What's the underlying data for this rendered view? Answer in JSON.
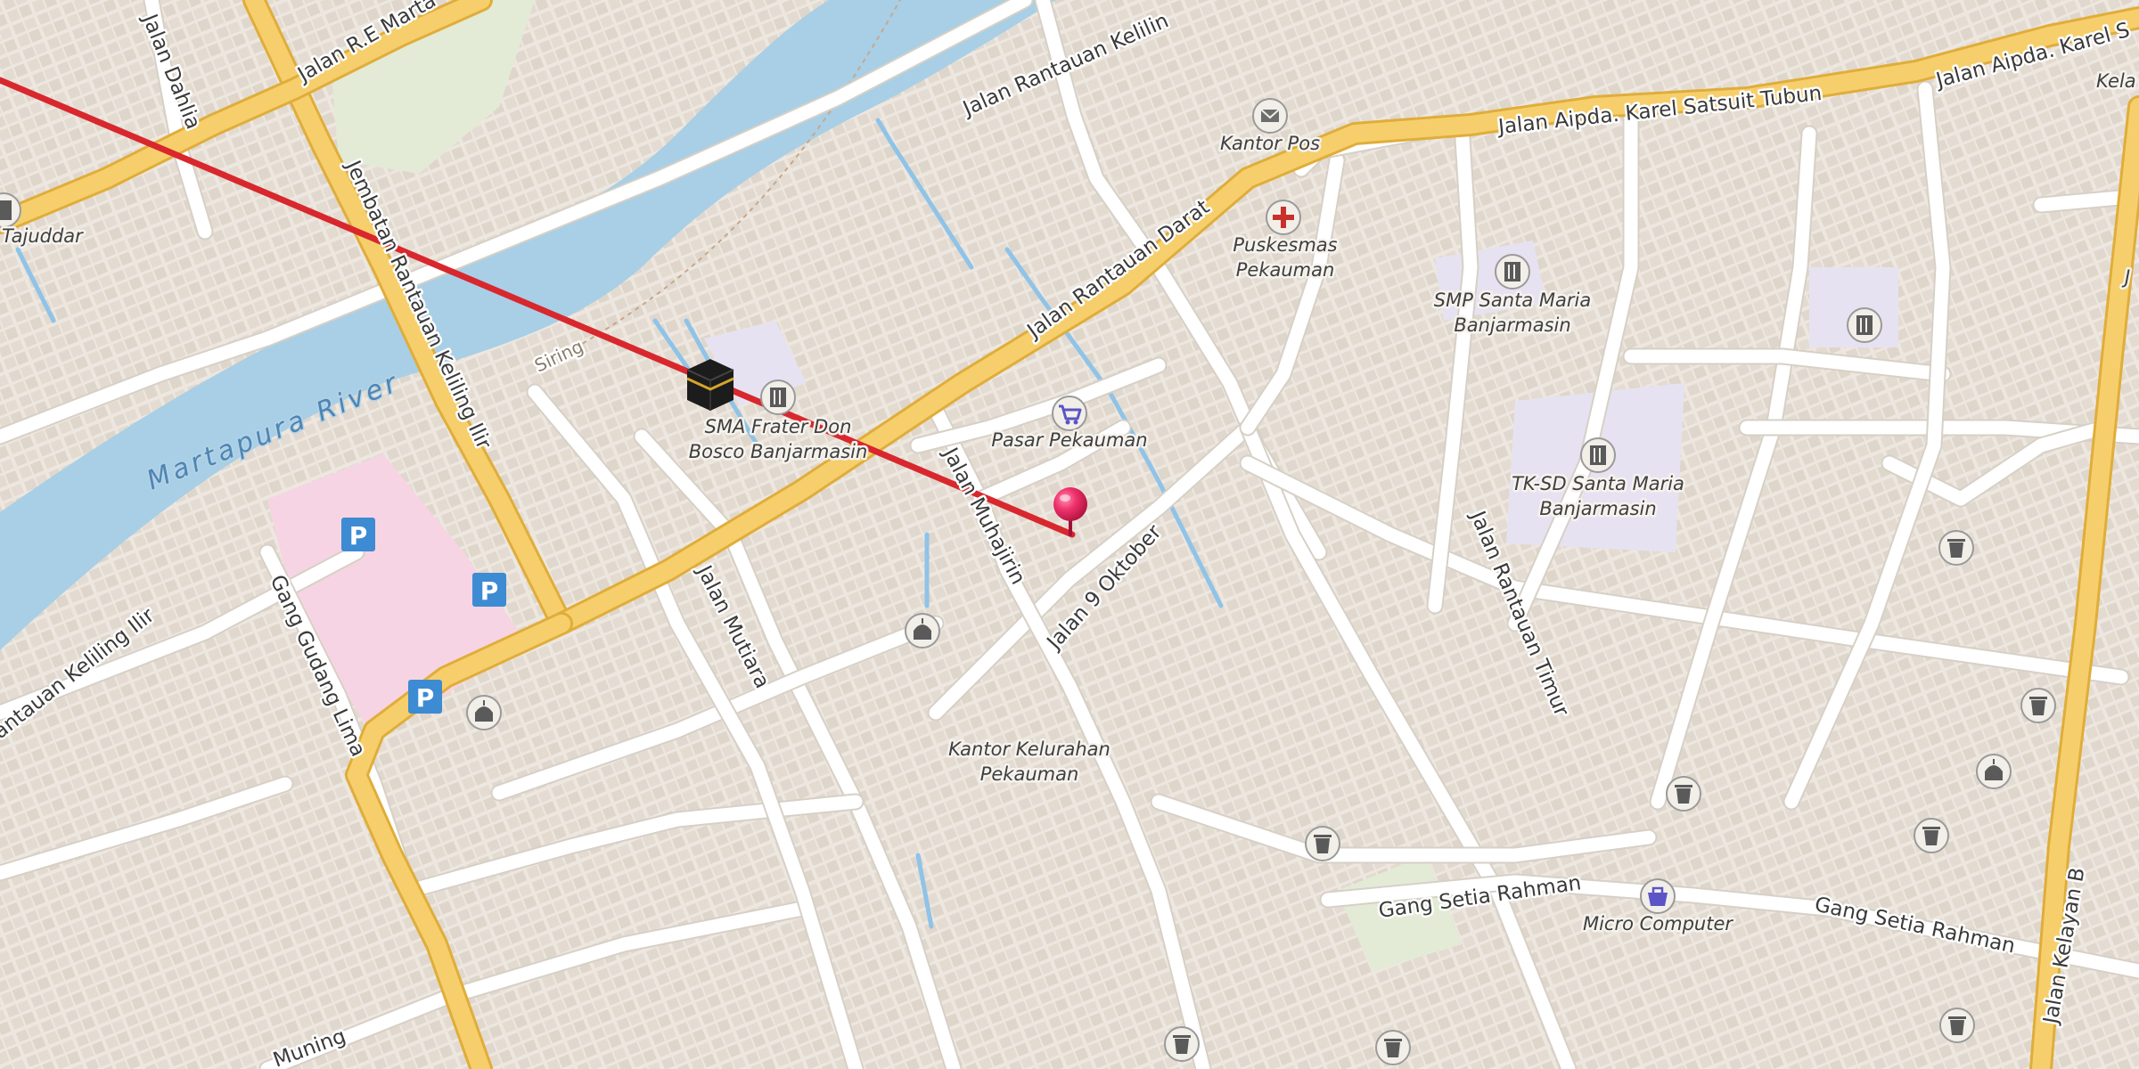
{
  "map": {
    "colors": {
      "land": "#f2efe9",
      "buildings": "#e3dbd1",
      "river": "#a8cfe6",
      "major_road": "#f6cf6c",
      "major_road_casing": "#e0ad3a",
      "minor_road": "#ffffff",
      "hospital_area": "#f7d4e3",
      "school_area": "#e7e2f1",
      "park_area": "#e3ebd6",
      "route_line": "#d8272d",
      "pin": "#e8245c",
      "parking": "#3d8bd3"
    },
    "river_name": "Martapura River",
    "embankment_name": "Siring",
    "roads": {
      "dahlia": "Jalan Dahlia",
      "re_martadinata": "Jalan R.E Marta",
      "rantauan_keliling_top": "Jalan Rantauan Kelilin",
      "aipda_karel_1": "Jalan Aipda. Karel Satsuit Tubun",
      "aipda_karel_2": "Jalan Aipda. Karel S",
      "jembatan": "Jembatan Rantauan Keliling Ilir",
      "rantauan_darat": "Jalan Rantauan Darat",
      "keliling_ilir": "antauan Keliling Ilir",
      "gudang_lima": "Gang Gudang Lima",
      "mutiara": "Jalan Mutiara",
      "muhajirin": "Jalan Muhajirin",
      "sembilan_oktober": "Jalan 9 Oktober",
      "rantauan_timur": "Jalan Rantauan Timur",
      "setia_rahman_1": "Gang Setia Rahman",
      "setia_rahman_2": "Gang Setia Rahman",
      "kelayan_b": "Jalan Kelayan B",
      "muning": "Muning"
    },
    "places": {
      "tajuddar": "Tajuddar",
      "kantor_pos": "Kantor Pos",
      "puskesmas_1": "Puskesmas",
      "puskesmas_2": "Pekauman",
      "smp_1": "SMP Santa Maria",
      "smp_2": "Banjarmasin",
      "sma_1": "SMA Frater Don",
      "sma_2": "Bosco Banjarmasin",
      "pasar": "Pasar Pekauman",
      "tksd_1": "TK-SD Santa Maria",
      "tksd_2": "Banjarmasin",
      "kelurahan_1": "Kantor Kelurahan",
      "kelurahan_2": "Pekauman",
      "micro_computer": "Micro Computer",
      "kela": "Kela",
      "j_edge": "J"
    },
    "parking_symbol": "P"
  }
}
